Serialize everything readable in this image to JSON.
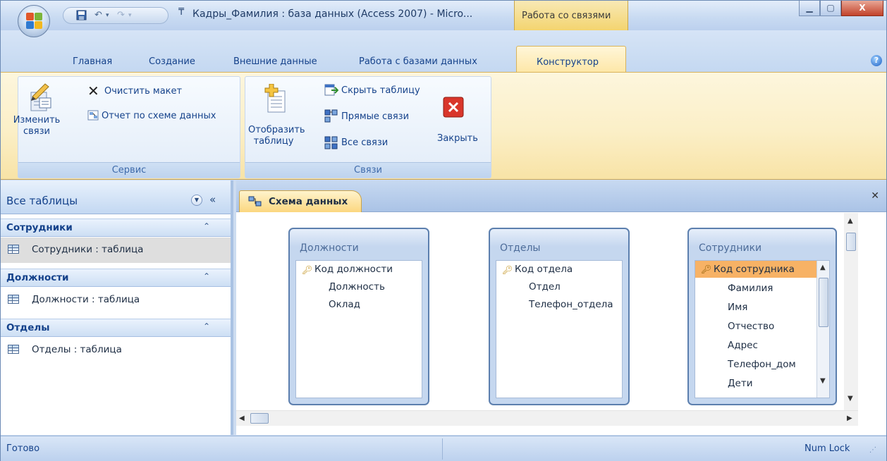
{
  "window": {
    "title": "Кадры_Фамилия : база данных (Access 2007) - Micro...",
    "context_tab_title": "Работа со связями",
    "buttons": {
      "minimize": "–",
      "maximize": "□",
      "close": "X"
    }
  },
  "ribbon_tabs": [
    "Главная",
    "Создание",
    "Внешние данные",
    "Работа с базами данных",
    "Конструктор"
  ],
  "ribbon": {
    "groups": [
      {
        "label": "Сервис",
        "edit_relations": "Изменить связи",
        "clear_layout": "Очистить макет",
        "relations_report": "Отчет по схеме данных"
      },
      {
        "label": "Связи",
        "show_table": "Отобразить таблицу",
        "hide_table": "Скрыть таблицу",
        "direct_relations": "Прямые связи",
        "all_relations": "Все связи",
        "close": "Закрыть"
      }
    ]
  },
  "nav": {
    "header": "Все таблицы",
    "groups": [
      {
        "title": "Сотрудники",
        "item": "Сотрудники : таблица",
        "selected": true
      },
      {
        "title": "Должности",
        "item": "Должности : таблица",
        "selected": false
      },
      {
        "title": "Отделы",
        "item": "Отделы : таблица",
        "selected": false
      }
    ]
  },
  "document": {
    "tab_title": "Схема данных",
    "tables": [
      {
        "name": "Должности",
        "fields": [
          "Код должности",
          "Должность",
          "Оклад"
        ],
        "key_field": 0
      },
      {
        "name": "Отделы",
        "fields": [
          "Код отдела",
          "Отдел",
          "Телефон_отдела"
        ],
        "key_field": 0
      },
      {
        "name": "Сотрудники",
        "fields": [
          "Код сотрудника",
          "Фамилия",
          "Имя",
          "Отчество",
          "Адрес",
          "Телефон_дом",
          "Дети"
        ],
        "key_field": 0
      }
    ]
  },
  "status": {
    "left": "Готово",
    "right": "Num Lock"
  },
  "colors": {
    "accent": "#15428b",
    "context_tab": "#f3d36c",
    "highlight_field": "#f7b265"
  }
}
